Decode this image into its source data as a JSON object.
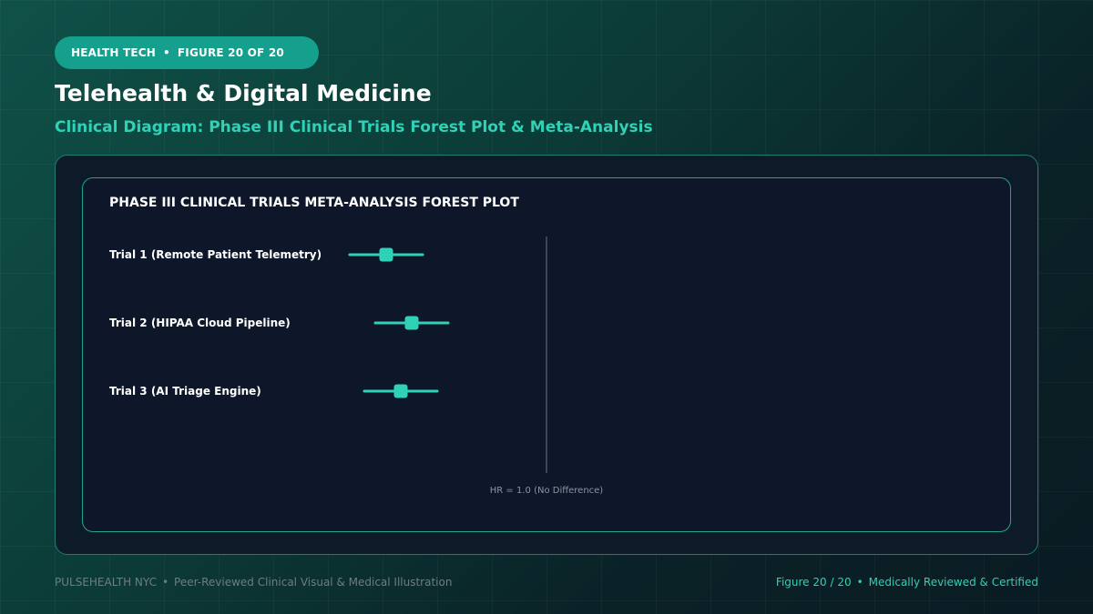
{
  "badge": {
    "category": "HEALTH TECH",
    "separator": "•",
    "figure": "FIGURE 20 OF 20"
  },
  "header": {
    "title": "Telehealth & Digital Medicine",
    "subtitle": "Clinical Diagram: Phase III Clinical Trials Forest Plot & Meta-Analysis"
  },
  "chart_data": {
    "type": "forest",
    "title": "PHASE III CLINICAL TRIALS META-ANALYSIS FOREST PLOT",
    "reference_line": {
      "value": 1.0,
      "label": "HR = 1.0 (No Difference)"
    },
    "scale": {
      "reference_at": 1.0,
      "units_per_interval": 0.1
    },
    "trials": [
      {
        "label": "Trial 1 (Remote Patient Telemetry)",
        "estimate": 0.56,
        "ci_low": 0.46,
        "ci_high": 0.66
      },
      {
        "label": "Trial 2 (HIPAA Cloud Pipeline)",
        "estimate": 0.63,
        "ci_low": 0.53,
        "ci_high": 0.73
      },
      {
        "label": "Trial 3 (AI Triage Engine)",
        "estimate": 0.6,
        "ci_low": 0.5,
        "ci_high": 0.7
      }
    ],
    "colors": {
      "marker": "#2fd1b7",
      "reference": "#4a5566"
    }
  },
  "footer": {
    "brand": "PULSEHEALTH NYC",
    "separator": "•",
    "tagline": "Peer-Reviewed Clinical Visual & Medical Illustration",
    "figure": "Figure 20 / 20",
    "certification": "Medically Reviewed & Certified"
  }
}
